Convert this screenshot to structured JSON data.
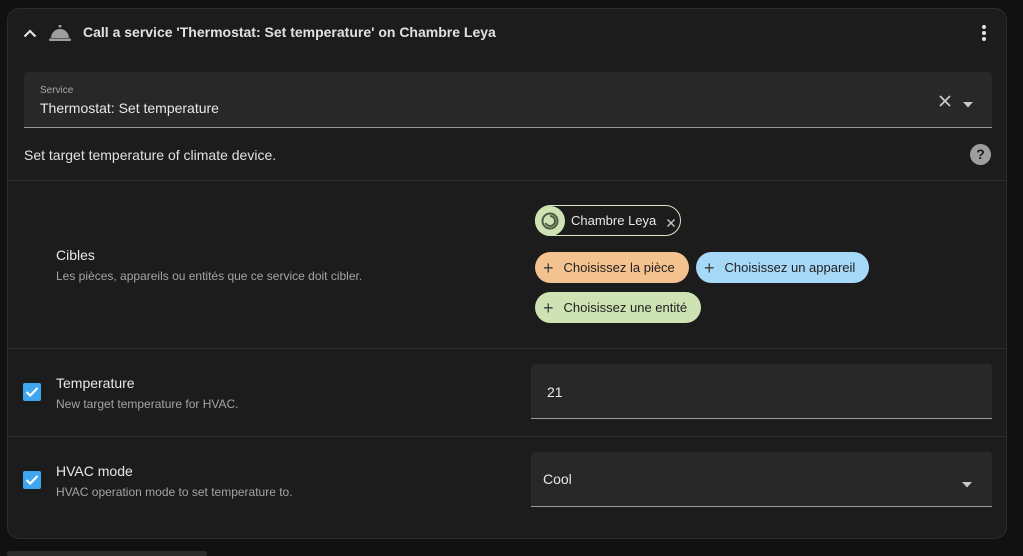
{
  "header": {
    "title": "Call a service 'Thermostat: Set temperature' on Chambre Leya",
    "collapse_icon": "chevron-up-icon",
    "service_icon": "room-service-icon",
    "menu_icon": "dots-vertical-icon"
  },
  "service": {
    "label": "Service",
    "value": "Thermostat: Set temperature",
    "description": "Set target temperature of climate device.",
    "help_glyph": "?"
  },
  "targets": {
    "title": "Cibles",
    "subtitle": "Les pièces, appareils ou entités que ce service doit cibler.",
    "selected_chip": "Chambre Leya",
    "add_area": "Choisissez la pièce",
    "add_device": "Choisissez un appareil",
    "add_entity": "Choisissez une entité",
    "colors": {
      "area": "#f4c28f",
      "device": "#a6d8f7",
      "entity": "#cde3b4"
    }
  },
  "temperature": {
    "title": "Temperature",
    "subtitle": "New target temperature for HVAC.",
    "value": "21",
    "checked": true
  },
  "hvac_mode": {
    "title": "HVAC mode",
    "subtitle": "HVAC operation mode to set temperature to.",
    "value": "Cool",
    "checked": true
  },
  "colors": {
    "accent": "#3fa7f2",
    "background": "#1c1c1c"
  }
}
